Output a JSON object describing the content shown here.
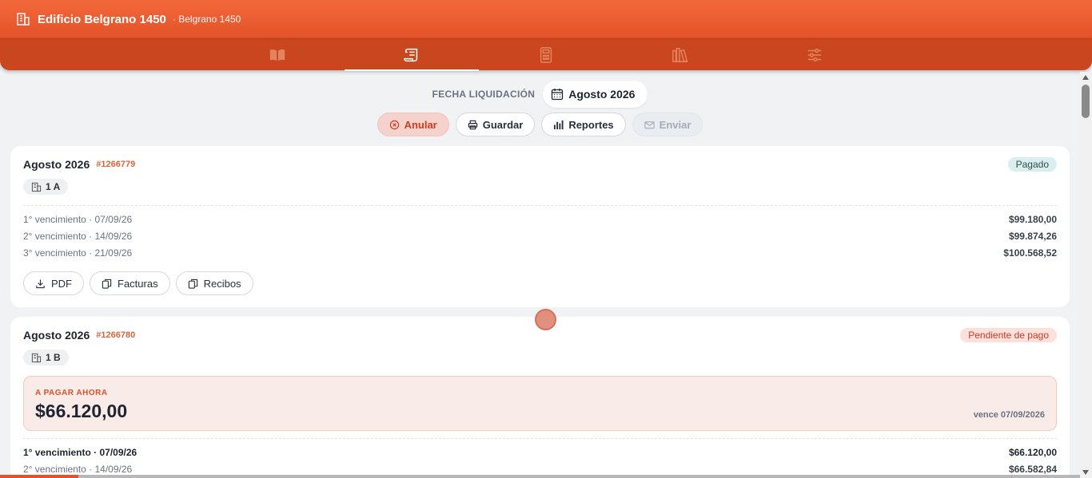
{
  "header": {
    "title": "Edificio Belgrano 1450",
    "subtitle": "· Belgrano 1450",
    "building_icon": "building-icon"
  },
  "nav": {
    "tabs": [
      {
        "icon": "book-icon",
        "active": false
      },
      {
        "icon": "receipt-icon",
        "active": true
      },
      {
        "icon": "calculator-icon",
        "active": false
      },
      {
        "icon": "library-icon",
        "active": false
      },
      {
        "icon": "sliders-icon",
        "active": false
      }
    ]
  },
  "fecha": {
    "label": "FECHA LIQUIDACIÓN",
    "value": "Agosto 2026",
    "icon": "calendar-icon"
  },
  "actions": {
    "anular": "Anular",
    "guardar": "Guardar",
    "reportes": "Reportes",
    "enviar": "Enviar"
  },
  "cards": [
    {
      "period": "Agosto 2026",
      "number": "#1266779",
      "status": "Pagado",
      "unit": "1 A",
      "vencimientos": [
        {
          "label": "1° vencimiento · 07/09/26",
          "amount": "$99.180,00"
        },
        {
          "label": "2° vencimiento · 14/09/26",
          "amount": "$99.874,26"
        },
        {
          "label": "3° vencimiento · 21/09/26",
          "amount": "$100.568,52"
        }
      ],
      "docs": {
        "pdf": "PDF",
        "facturas": "Facturas",
        "recibos": "Recibos"
      }
    },
    {
      "period": "Agosto 2026",
      "number": "#1266780",
      "status": "Pendiente de pago",
      "unit": "1 B",
      "pagar": {
        "label": "A PAGAR AHORA",
        "amount": "$66.120,00",
        "vence": "vence 07/09/2026"
      },
      "vencimientos": [
        {
          "label": "1° vencimiento · 07/09/26",
          "amount": "$66.120,00"
        },
        {
          "label": "2° vencimiento · 14/09/26",
          "amount": "$66.582,84"
        }
      ]
    }
  ],
  "colors": {
    "accent": "#e4522a",
    "nav": "#c9461f",
    "paid_bg": "#dbeeee",
    "pending_bg": "#fbe0db"
  }
}
